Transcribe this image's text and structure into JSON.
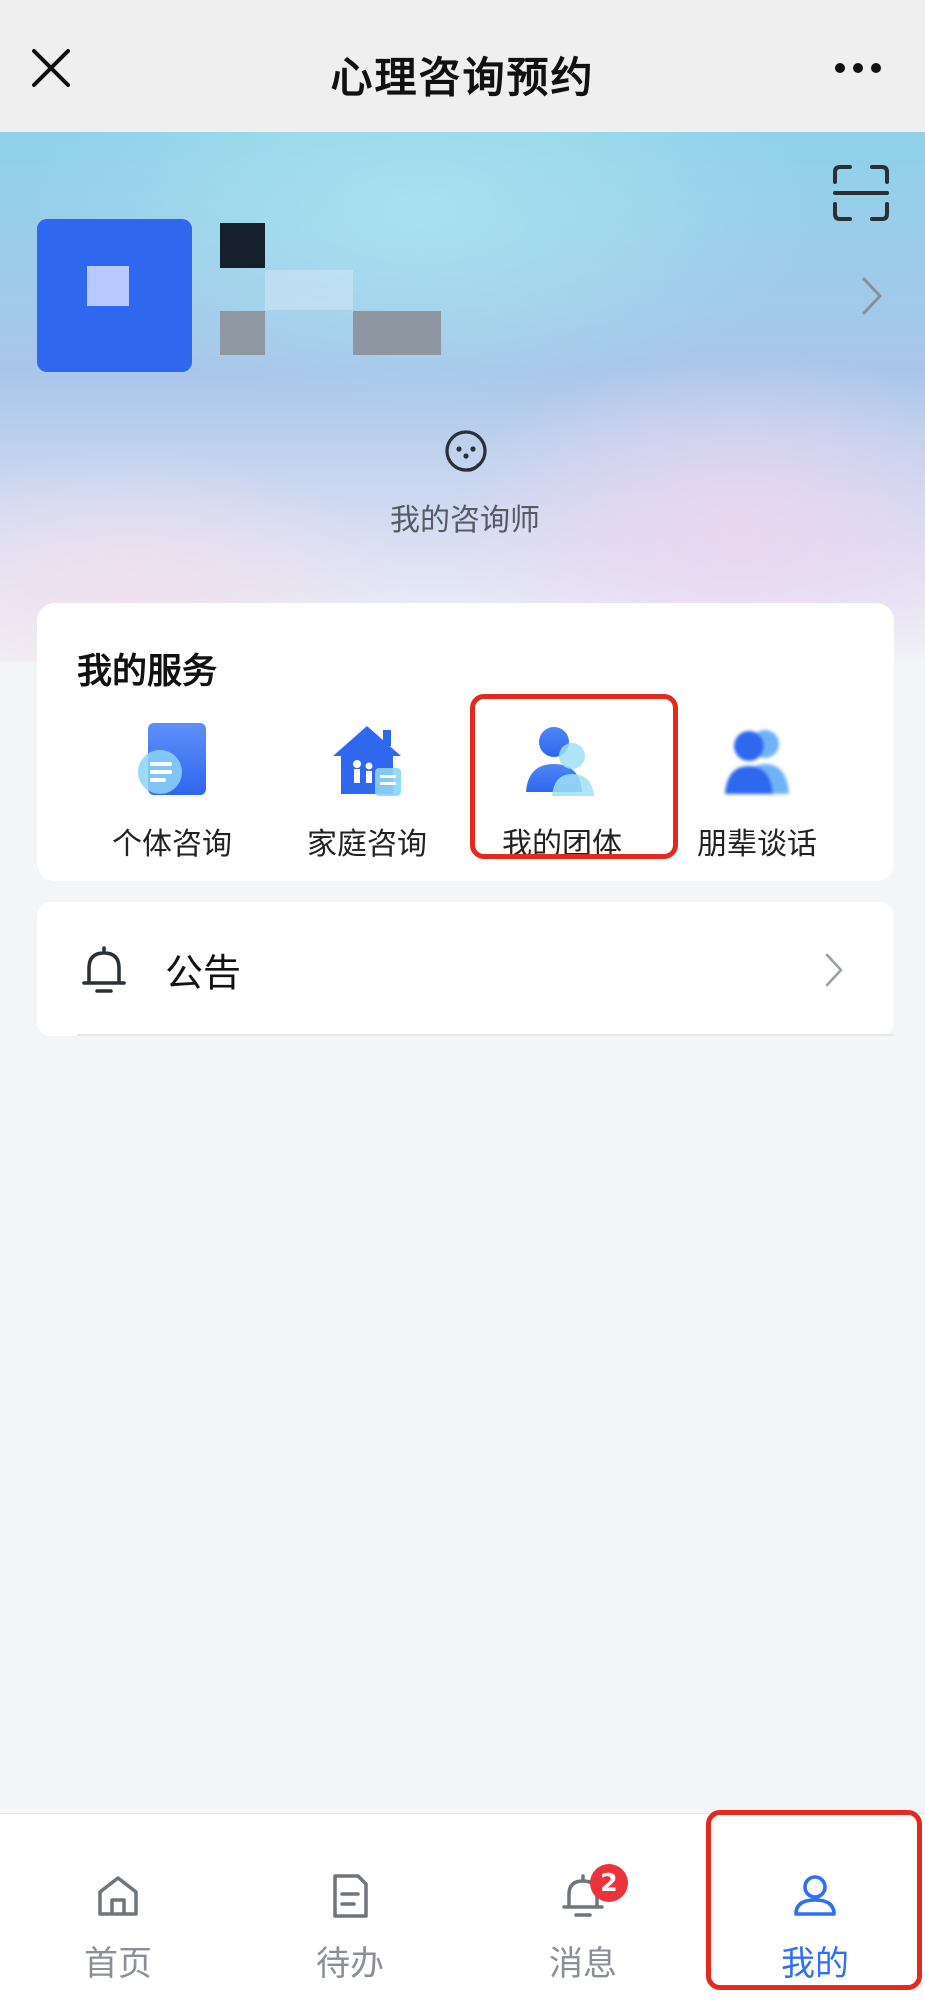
{
  "navbar": {
    "title": "心理咨询预约",
    "close_icon": "close-icon",
    "more_icon": "more-icon"
  },
  "profile": {
    "scan_icon": "scan-icon",
    "chevron_icon": "chevron-right-icon",
    "consultant_label": "我的咨询师",
    "consultant_icon": "headset-icon"
  },
  "services": {
    "title": "我的服务",
    "items": [
      {
        "label": "个体咨询",
        "icon": "document-chat-icon"
      },
      {
        "label": "家庭咨询",
        "icon": "house-family-icon"
      },
      {
        "label": "我的团体",
        "icon": "group-person-icon"
      },
      {
        "label": "朋辈谈话",
        "icon": "peer-talk-icon"
      }
    ]
  },
  "notice": {
    "label": "公告",
    "icon": "bell-icon"
  },
  "tabbar": {
    "items": [
      {
        "label": "首页",
        "icon": "home-icon"
      },
      {
        "label": "待办",
        "icon": "todo-icon"
      },
      {
        "label": "消息",
        "icon": "bell-icon",
        "badge": "2"
      },
      {
        "label": "我的",
        "icon": "user-icon"
      }
    ],
    "active_index": 3
  },
  "colors": {
    "accent": "#2f6ff2",
    "highlight_border": "#e42a1f",
    "badge": "#e8343a"
  }
}
